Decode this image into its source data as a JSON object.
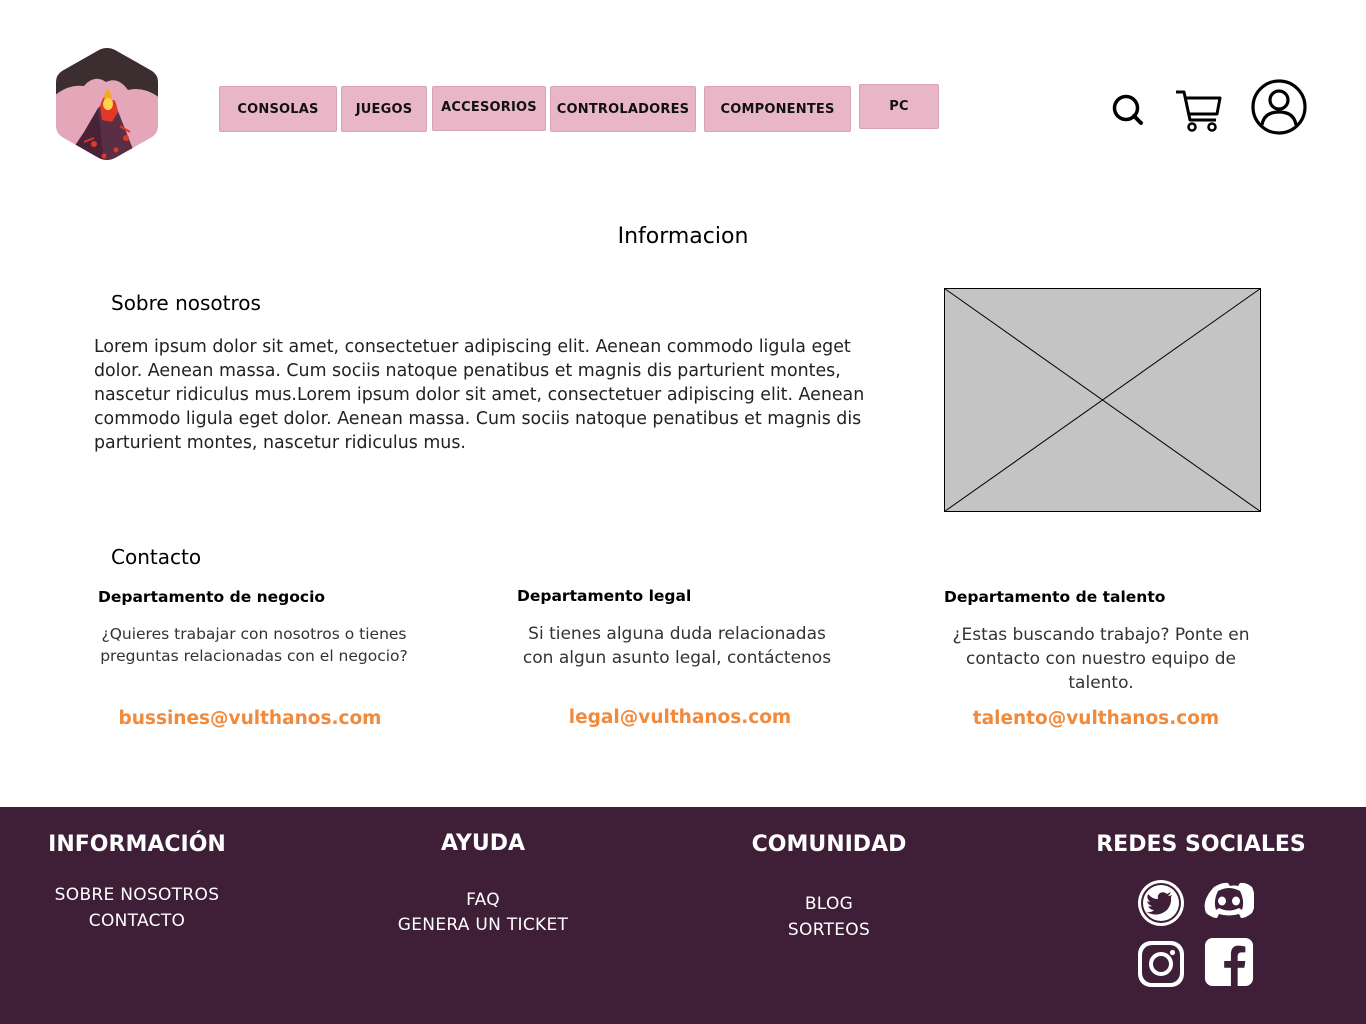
{
  "header": {
    "nav": [
      {
        "label": "CONSOLAS"
      },
      {
        "label": "JUEGOS"
      },
      {
        "label": "ACCESORIOS"
      },
      {
        "label": "CONTROLADORES"
      },
      {
        "label": "COMPONENTES"
      },
      {
        "label": "PC"
      }
    ],
    "icons": [
      "search-icon",
      "cart-icon",
      "user-icon"
    ]
  },
  "main": {
    "title": "Informacion",
    "about": {
      "heading": "Sobre nosotros",
      "text": "Lorem ipsum dolor sit amet, consectetuer adipiscing elit. Aenean commodo ligula eget dolor. Aenean massa. Cum sociis natoque penatibus et magnis dis parturient montes, nascetur ridiculus mus.Lorem ipsum dolor sit amet, consectetuer adipiscing elit. Aenean commodo ligula eget dolor. Aenean massa. Cum sociis natoque penatibus et magnis dis parturient montes, nascetur ridiculus mus."
    },
    "contact": {
      "heading": "Contacto",
      "departments": [
        {
          "title": "Departamento de negocio",
          "desc": "¿Quieres trabajar con nosotros o tienes  preguntas relacionadas con el negocio?",
          "email": "bussines@vulthanos.com"
        },
        {
          "title": "Departamento legal",
          "desc": "Si tienes alguna duda relacionadas con algun asunto legal, contáctenos",
          "email": "legal@vulthanos.com"
        },
        {
          "title": "Departamento de talento",
          "desc": "¿Estas buscando trabajo? Ponte en contacto con nuestro equipo de talento.",
          "email": "talento@vulthanos.com"
        }
      ]
    }
  },
  "footer": {
    "info": {
      "heading": "INFORMACIÓN",
      "links": [
        "SOBRE NOSOTROS",
        "CONTACTO"
      ]
    },
    "help": {
      "heading": "AYUDA",
      "links": [
        "FAQ",
        "GENERA UN TICKET"
      ]
    },
    "community": {
      "heading": "COMUNIDAD",
      "links": [
        "BLOG",
        "SORTEOS"
      ]
    },
    "social": {
      "heading": "REDES SOCIALES",
      "icons": [
        "twitter-icon",
        "discord-icon",
        "instagram-icon",
        "facebook-icon"
      ]
    }
  },
  "colors": {
    "nav_bg": "#e8b6c6",
    "accent": "#f08a3c",
    "footer_bg": "#3e1f37"
  }
}
